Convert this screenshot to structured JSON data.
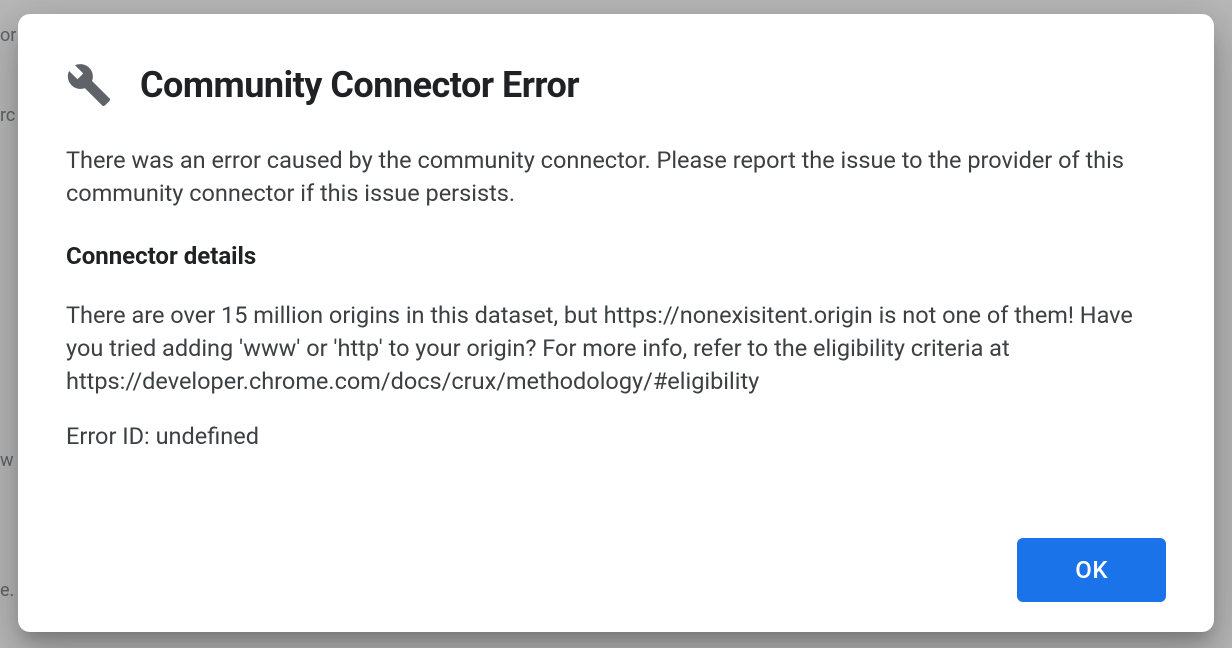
{
  "dialog": {
    "title": "Community Connector Error",
    "intro": "There was an error caused by the community connector. Please report the issue to the provider of this community connector if this issue persists.",
    "details_heading": "Connector details",
    "details_body": "There are over 15 million origins in this dataset, but https://nonexisitent.origin is not one of them! Have you tried adding 'www' or 'http' to your origin? For more info, refer to the eligibility criteria at https://developer.chrome.com/docs/crux/methodology/#eligibility",
    "error_id": "Error ID: undefined",
    "ok_label": "OK"
  },
  "background": {
    "text1": "or",
    "text2": "rc",
    "text3": "w",
    "text4": "e."
  }
}
